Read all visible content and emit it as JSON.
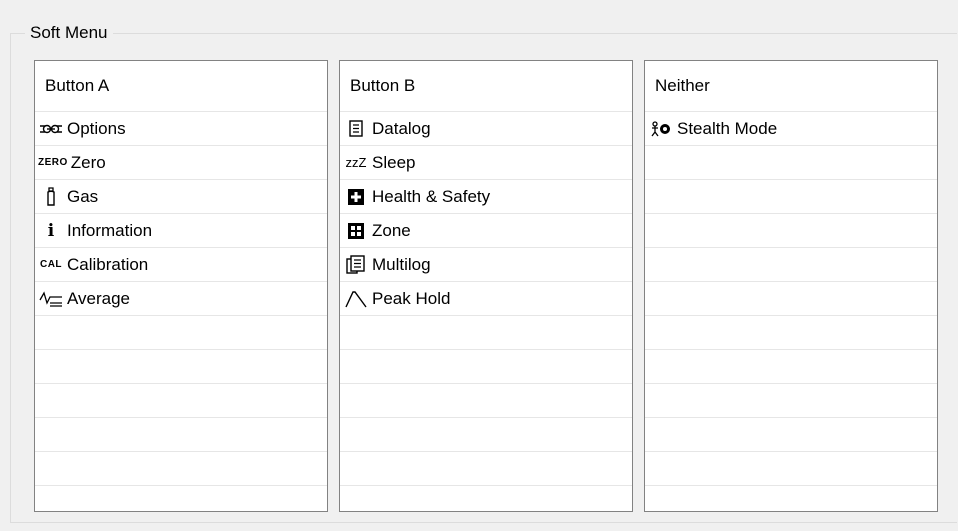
{
  "group_title": "Soft Menu",
  "columns": [
    {
      "header": "Button A",
      "items": [
        {
          "icon": "options-icon",
          "label": "Options"
        },
        {
          "icon": "zero-icon",
          "icon_text": "ZERO",
          "label": "Zero"
        },
        {
          "icon": "gas-cylinder-icon",
          "label": "Gas"
        },
        {
          "icon": "information-icon",
          "icon_text": "i",
          "label": "Information"
        },
        {
          "icon": "calibration-icon",
          "icon_text": "CAL",
          "label": "Calibration"
        },
        {
          "icon": "average-icon",
          "label": "Average"
        }
      ]
    },
    {
      "header": "Button B",
      "items": [
        {
          "icon": "datalog-icon",
          "label": "Datalog"
        },
        {
          "icon": "sleep-icon",
          "icon_text": "zzZ",
          "label": "Sleep"
        },
        {
          "icon": "health-safety-icon",
          "label": "Health & Safety"
        },
        {
          "icon": "zone-icon",
          "label": "Zone"
        },
        {
          "icon": "multilog-icon",
          "label": "Multilog"
        },
        {
          "icon": "peak-hold-icon",
          "label": "Peak Hold"
        }
      ]
    },
    {
      "header": "Neither",
      "items": [
        {
          "icon": "stealth-mode-icon",
          "label": "Stealth Mode"
        }
      ]
    }
  ]
}
